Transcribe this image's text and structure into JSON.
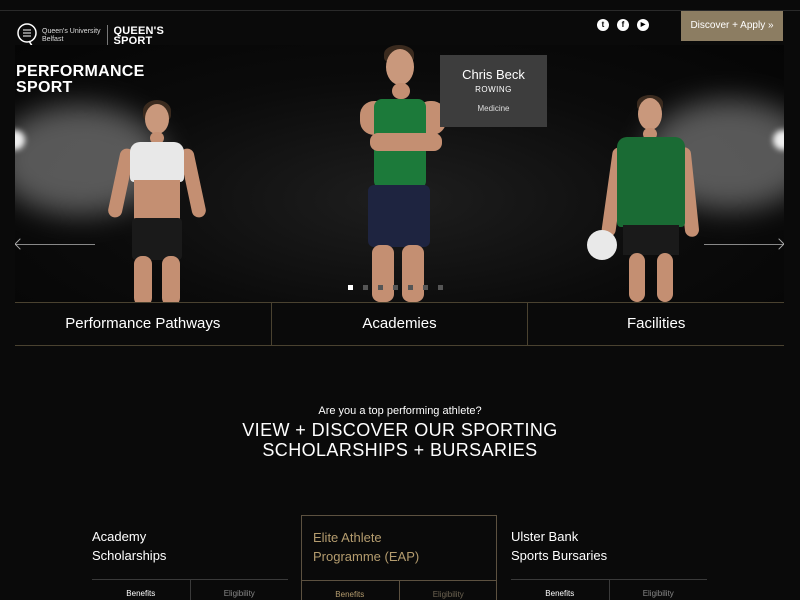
{
  "header": {
    "university_name": "Queen's University",
    "university_sub": "Belfast",
    "brand_line1": "QUEEN'S",
    "brand_line2": "SPORT",
    "apply_button": "Discover + Apply »",
    "socials": [
      {
        "icon": "twitter-icon",
        "glyph": "t"
      },
      {
        "icon": "facebook-icon",
        "glyph": "f"
      },
      {
        "icon": "youtube-icon",
        "glyph": "▶"
      }
    ]
  },
  "hero": {
    "title_line1": "PERFORMANCE",
    "title_line2": "SPORT",
    "caption": {
      "name": "Chris Beck",
      "sport": "ROWING",
      "course": "Medicine"
    },
    "slide_count": 7,
    "active_slide": 1
  },
  "nav_tabs": [
    {
      "label": "Performance Pathways"
    },
    {
      "label": "Academies"
    },
    {
      "label": "Facilities"
    }
  ],
  "cta": {
    "question": "Are you a top performing athlete?",
    "title_line1": "VIEW + DISCOVER OUR SPORTING",
    "title_line2": "SCHOLARSHIPS + BURSARIES"
  },
  "cards": [
    {
      "line1": "Academy",
      "line2": "Scholarships",
      "tab1": "Benefits",
      "tab2": "Eligibility"
    },
    {
      "line1": "Elite Athlete",
      "line2": "Programme (EAP)",
      "tab1": "Benefits",
      "tab2": "Eligibility"
    },
    {
      "line1": "Ulster Bank",
      "line2": "Sports Bursaries",
      "tab1": "Benefits",
      "tab2": "Eligibility"
    }
  ],
  "colors": {
    "accent_gold": "#8c7d62",
    "featured_text": "#b49c6e",
    "background": "#0a0a0a"
  }
}
